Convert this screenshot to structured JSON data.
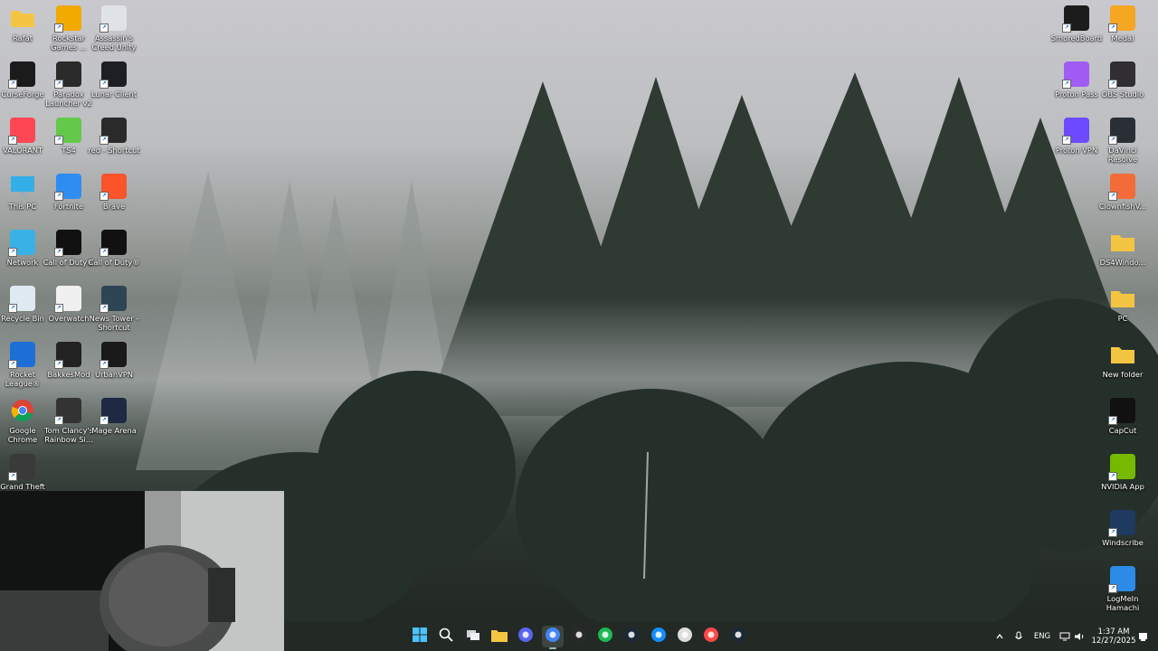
{
  "desktop": {
    "left_icons": [
      {
        "label": "Rafat",
        "icon": "folder-icon",
        "color": "#f4c542"
      },
      {
        "label": "Rockstar Games ...",
        "icon": "rockstar-icon",
        "color": "#f2a900"
      },
      {
        "label": "Assassin's Creed Unity",
        "icon": "assassins-creed-icon",
        "color": "#dfe3e8"
      },
      {
        "label": "CurseForge",
        "icon": "curseforge-icon",
        "color": "#1b1b1b"
      },
      {
        "label": "Paradox Launcher v2",
        "icon": "paradox-icon",
        "color": "#2b2b2b"
      },
      {
        "label": "Lunar Client",
        "icon": "lunar-client-icon",
        "color": "#1c1f24"
      },
      {
        "label": "VALORANT",
        "icon": "valorant-icon",
        "color": "#ff4655"
      },
      {
        "label": "TS4",
        "icon": "sims4-icon",
        "color": "#64c84a"
      },
      {
        "label": "red - Shortcut",
        "icon": "red-shortcut-icon",
        "color": "#2a2a2a"
      },
      {
        "label": "This PC",
        "icon": "this-pc-icon",
        "color": "#33aee8"
      },
      {
        "label": "Fortnite",
        "icon": "fortnite-icon",
        "color": "#2f8cf0"
      },
      {
        "label": "Brave",
        "icon": "brave-icon",
        "color": "#fb542b"
      },
      {
        "label": "Network",
        "icon": "network-icon",
        "color": "#3ab1e6"
      },
      {
        "label": "Call of Duty®",
        "icon": "call-of-duty-icon",
        "color": "#111111"
      },
      {
        "label": "Call of Duty®",
        "icon": "call-of-duty-icon",
        "color": "#111111"
      },
      {
        "label": "Recycle Bin",
        "icon": "recycle-bin-icon",
        "color": "#dfe9f2"
      },
      {
        "label": "Overwatch",
        "icon": "overwatch-icon",
        "color": "#f0f0f0"
      },
      {
        "label": "News Tower - Shortcut",
        "icon": "news-tower-icon",
        "color": "#2e4556"
      },
      {
        "label": "Rocket League®",
        "icon": "rocket-league-icon",
        "color": "#1d6fd8"
      },
      {
        "label": "BakkesMod",
        "icon": "bakkesmod-icon",
        "color": "#222222"
      },
      {
        "label": "UrbanVPN",
        "icon": "urbanvpn-icon",
        "color": "#1a1a1a"
      },
      {
        "label": "Google Chrome",
        "icon": "chrome-icon",
        "color": "#4285f4"
      },
      {
        "label": "Tom Clancy's Rainbow Si...",
        "icon": "rainbow-six-icon",
        "color": "#333333"
      },
      {
        "label": "Mage Arena",
        "icon": "mage-arena-icon",
        "color": "#1e2a44"
      },
      {
        "label": "Grand Theft Auto V",
        "icon": "gta-v-icon",
        "color": "#3a3a3a"
      }
    ],
    "right_icons": [
      {
        "label": "SmoredBoard",
        "icon": "soundboard-icon",
        "color": "#1c1c1c"
      },
      {
        "label": "Medal",
        "icon": "medal-icon",
        "color": "#f5a623"
      },
      {
        "label": "Proton Pass",
        "icon": "proton-pass-icon",
        "color": "#a15cf6"
      },
      {
        "label": "OBS Studio",
        "icon": "obs-icon",
        "color": "#302e31"
      },
      {
        "label": "Proton VPN",
        "icon": "proton-vpn-icon",
        "color": "#6d4aff"
      },
      {
        "label": "DaVinci Resolve",
        "icon": "davinci-resolve-icon",
        "color": "#2a2f36"
      },
      {
        "label": "ClownfishV...",
        "icon": "clownfish-icon",
        "color": "#f26b38"
      },
      {
        "label": "DS4Windo...",
        "icon": "folder-icon",
        "color": "#f4c542"
      },
      {
        "label": "PC",
        "icon": "folder-icon",
        "color": "#f4c542"
      },
      {
        "label": "New folder",
        "icon": "folder-icon",
        "color": "#f4c542"
      },
      {
        "label": "CapCut",
        "icon": "capcut-icon",
        "color": "#111111"
      },
      {
        "label": "NVIDIA App",
        "icon": "nvidia-icon",
        "color": "#76b900"
      },
      {
        "label": "Windscribe",
        "icon": "windscribe-icon",
        "color": "#1f3a5f"
      },
      {
        "label": "LogMeIn Hamachi",
        "icon": "hamachi-icon",
        "color": "#2b8be6"
      }
    ]
  },
  "taskbar": {
    "apps": [
      {
        "name": "start-button",
        "icon": "windows-logo-icon",
        "color": "#4cc2ff"
      },
      {
        "name": "search-button",
        "icon": "search-icon",
        "color": "#ffffff"
      },
      {
        "name": "task-view-button",
        "icon": "task-view-icon",
        "color": "#dddddd"
      },
      {
        "name": "file-explorer-button",
        "icon": "folder-icon",
        "color": "#f4c542"
      },
      {
        "name": "discord-button",
        "icon": "discord-icon",
        "color": "#5865f2"
      },
      {
        "name": "chrome-button",
        "icon": "chrome-icon",
        "color": "#4285f4",
        "active": true
      },
      {
        "name": "epic-games-button",
        "icon": "epic-games-icon",
        "color": "#2a2a2a"
      },
      {
        "name": "spotify-button",
        "icon": "spotify-icon",
        "color": "#1db954"
      },
      {
        "name": "steam-button",
        "icon": "steam-icon",
        "color": "#1b2838"
      },
      {
        "name": "battlenet-button",
        "icon": "battlenet-icon",
        "color": "#148eff"
      },
      {
        "name": "app-button",
        "icon": "app-icon",
        "color": "#dddddd"
      },
      {
        "name": "ea-app-button",
        "icon": "ea-app-icon",
        "color": "#ff4747"
      },
      {
        "name": "steam-button-2",
        "icon": "steam-icon",
        "color": "#1b2838"
      }
    ],
    "tray": {
      "language": "ENG",
      "time": "1:37 AM",
      "date": "12/27/2025"
    }
  }
}
